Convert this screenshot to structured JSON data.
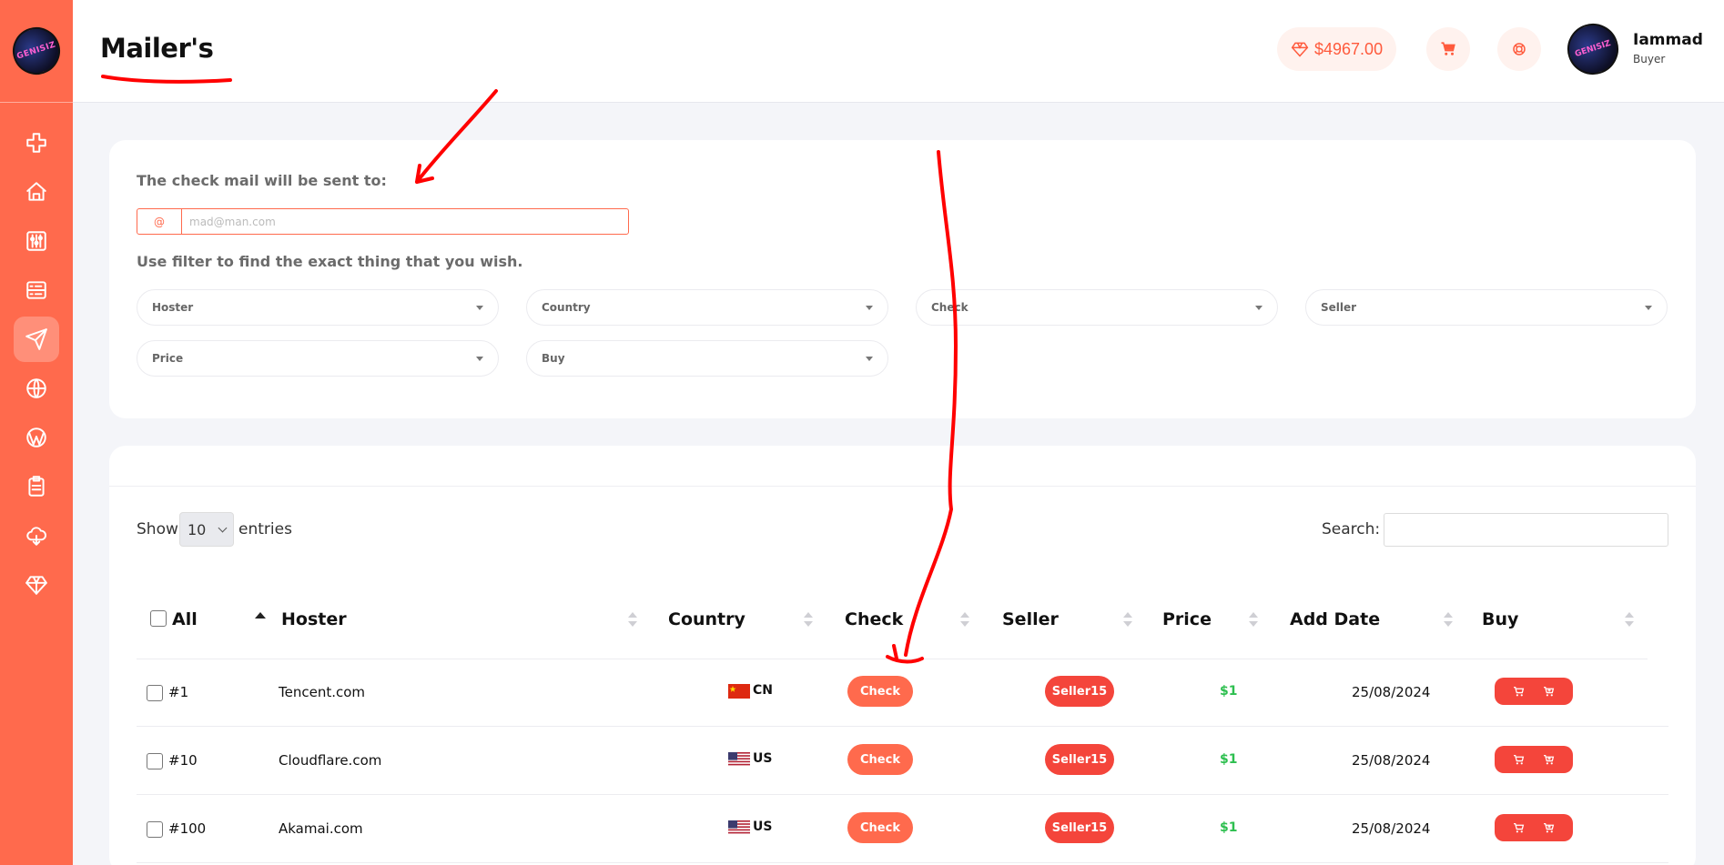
{
  "app": {
    "logo_text": "GENISIZ",
    "page_title": "Mailer's"
  },
  "sidebar": {
    "items": [
      {
        "icon": "plus-icon"
      },
      {
        "icon": "home-icon"
      },
      {
        "icon": "sliders-icon"
      },
      {
        "icon": "server-icon"
      },
      {
        "icon": "send-icon",
        "active": true
      },
      {
        "icon": "globe-icon"
      },
      {
        "icon": "wordpress-icon"
      },
      {
        "icon": "clipboard-icon"
      },
      {
        "icon": "cloud-icon"
      },
      {
        "icon": "diamond-icon"
      }
    ]
  },
  "header": {
    "balance": "$4967.00",
    "user_name": "Iammad",
    "user_role": "Buyer"
  },
  "filters": {
    "check_mail_label": "The check mail will be sent to:",
    "email_prefix": "@",
    "email_placeholder": "mad@man.com",
    "filter_label": "Use filter to find the exact thing that you wish.",
    "selects": [
      "Hoster",
      "Country",
      "Check",
      "Seller",
      "Price",
      "Buy"
    ]
  },
  "table": {
    "show_label": "Show",
    "entries_value": "10",
    "entries_label": "entries",
    "search_label": "Search:",
    "columns": [
      "All",
      "Hoster",
      "Country",
      "Check",
      "Seller",
      "Price",
      "Add Date",
      "Buy"
    ],
    "rows": [
      {
        "id": "#1",
        "hoster": "Tencent.com",
        "country": "CN",
        "check": "Check",
        "seller": "Seller15",
        "price": "$1",
        "date": "25/08/2024"
      },
      {
        "id": "#10",
        "hoster": "Cloudflare.com",
        "country": "US",
        "check": "Check",
        "seller": "Seller15",
        "price": "$1",
        "date": "25/08/2024"
      },
      {
        "id": "#100",
        "hoster": "Akamai.com",
        "country": "US",
        "check": "Check",
        "seller": "Seller15",
        "price": "$1",
        "date": "25/08/2024"
      }
    ]
  },
  "colors": {
    "accent": "#ff6a4d",
    "seller_badge": "#f4453b",
    "price_green": "#2dbf4f",
    "annotation_red": "#ff0000"
  }
}
